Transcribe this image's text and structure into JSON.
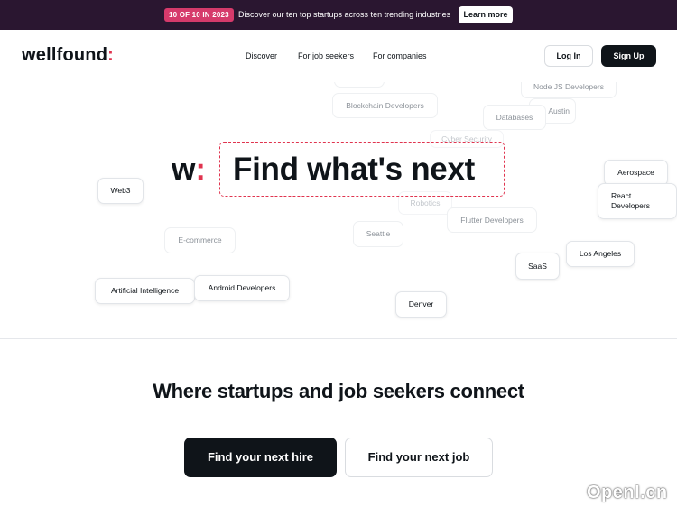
{
  "announcement": {
    "badge": "10 OF 10 IN 2023",
    "message": "Discover our ten top startups across ten trending industries",
    "cta": "Learn more"
  },
  "nav": {
    "logo_text": "wellfound",
    "logo_colon": ":",
    "links": [
      "Discover",
      "For job seekers",
      "For companies"
    ],
    "login": "Log In",
    "signup": "Sign Up"
  },
  "hero": {
    "mark_letter": "w",
    "mark_colon": ":",
    "headline": "Find what's next",
    "chips": [
      "Node JS Developers",
      "Blockchain Developers",
      "Austin",
      "Databases",
      "Cyber Security",
      "Web3",
      "Aerospace",
      "React Developers",
      "Robotics",
      "Flutter Developers",
      "E-commerce",
      "Seattle",
      "Los Angeles",
      "SaaS",
      "Artificial Intelligence",
      "Android Developers",
      "Denver"
    ]
  },
  "connect": {
    "tagline": "Where startups and job seekers connect",
    "hire_button": "Find your next hire",
    "job_button": "Find your next job"
  },
  "watermark": "OpenI.cn"
}
